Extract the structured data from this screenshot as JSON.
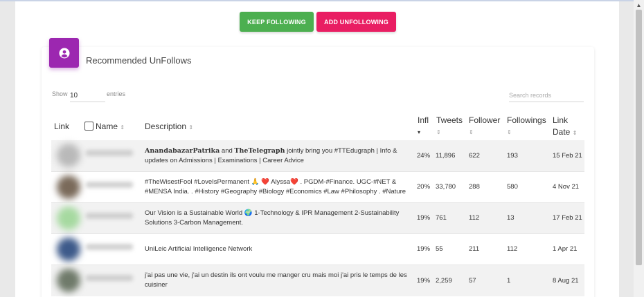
{
  "actions": {
    "keep_following": "KEEP FOLLOWING",
    "add_unfollowing": "ADD UNFOLLOWING"
  },
  "card": {
    "icon": "user-circle-icon",
    "title": "Recommended UnFollows"
  },
  "table_controls": {
    "show_label": "Show",
    "page_size": "10",
    "entries_label": "entries",
    "search_placeholder": "Search records"
  },
  "columns": {
    "link": "Link",
    "name": "Name",
    "description": "Description",
    "infl": "Infl",
    "tweets": "Tweets",
    "follower": "Follower",
    "followings": "Followings",
    "link_date_1": "Link",
    "link_date_2": "Date",
    "sort_glyph": "⇕",
    "sort_active_glyph": "▾"
  },
  "rows": [
    {
      "desc_bold_1": "AnandabazarPatrika",
      "desc_and": " and ",
      "desc_bold_2": "TheTelegraph",
      "desc_rest": " jointly bring you #TTEdugraph | Info & updates on Admissions | Examinations | Career Advice",
      "infl": "24%",
      "tweets": "11,896",
      "follower": "622",
      "followings": "193",
      "date": "15 Feb 21",
      "avatar_color": "#b9b9b9"
    },
    {
      "description": "#TheWisestFool #LoveIsPermanent 🙏 ❤️ Alyssa❤️ . PGDM-#Finance. UGC-#NET & #MENSA India. . #History #Geography #Biology #Economics #Law #Philosophy . #Nature",
      "infl": "20%",
      "tweets": "33,780",
      "follower": "288",
      "followings": "580",
      "date": "4 Nov 21",
      "avatar_color": "#7a6a5a"
    },
    {
      "description": "Our Vision is a Sustainable World 🌍 1-Technology & IPR Management 2-Sustainability Solutions 3-Carbon Management.",
      "infl": "19%",
      "tweets": "761",
      "follower": "112",
      "followings": "13",
      "date": "17 Feb 21",
      "avatar_color": "#a6d9a0"
    },
    {
      "description": "UniLeic Artificial Intelligence Network",
      "infl": "19%",
      "tweets": "55",
      "follower": "211",
      "followings": "112",
      "date": "1 Apr 21",
      "avatar_color": "#3d5a8a"
    },
    {
      "description": "j'ai pas une vie, j'ai un destin ils ont voulu me manger cru mais moi j'ai pris le temps de les cuisiner",
      "infl": "19%",
      "tweets": "2,259",
      "follower": "57",
      "followings": "1",
      "date": "8 Aug 21",
      "avatar_color": "#6f7a6a"
    }
  ]
}
